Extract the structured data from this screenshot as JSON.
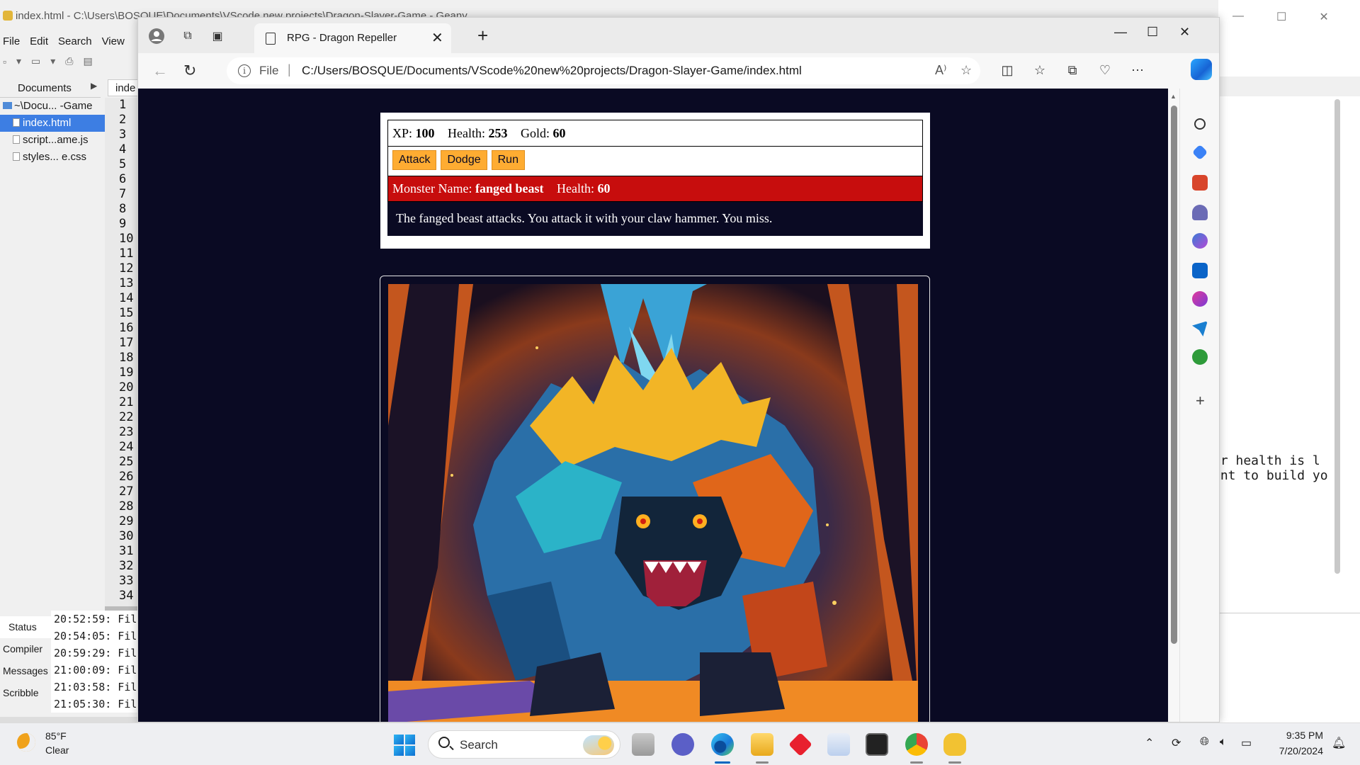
{
  "geany": {
    "title": "index.html - C:\\Users\\BOSQUE\\Documents\\VScode new projects\\Dragon-Slayer-Game - Geany",
    "menu": [
      "File",
      "Edit",
      "Search",
      "View"
    ],
    "sidebar_tab": "Documents",
    "tree": {
      "folder": "~\\Docu... -Game",
      "files": [
        "index.html",
        "script...ame.js",
        "styles...  e.css"
      ]
    },
    "editor_tab": "inde",
    "line_numbers": [
      "1",
      "2",
      "3",
      "4",
      "5",
      "6",
      "7",
      "8",
      "9",
      "10",
      "11",
      "12",
      "13",
      "14",
      "15",
      "16",
      "17",
      "18",
      "19",
      "20",
      "21",
      "22",
      "23",
      "24",
      "25",
      "26",
      "27",
      "28",
      "29",
      "30",
      "31",
      "32",
      "33",
      "34"
    ],
    "msg_tabs": [
      "Status",
      "Compiler",
      "Messages",
      "Scribble"
    ],
    "log": [
      "20:52:59: Fil",
      "20:54:05: Fil",
      "20:59:29: Fil",
      "21:00:09: Fil",
      "21:03:58: Fil",
      "21:05:30: Fil"
    ]
  },
  "background_window": {
    "text_lines": [
      "ur health is l",
      "ant to build yo"
    ]
  },
  "browser": {
    "tab_title": "RPG - Dragon Repeller",
    "url_scheme": "File",
    "url": "C:/Users/BOSQUE/Documents/VScode%20new%20projects/Dragon-Slayer-Game/index.html"
  },
  "game": {
    "stats": {
      "xp_label": "XP:",
      "xp": "100",
      "health_label": "Health:",
      "health": "253",
      "gold_label": "Gold:",
      "gold": "60"
    },
    "buttons": [
      "Attack",
      "Dodge",
      "Run"
    ],
    "monster": {
      "name_label": "Monster Name:",
      "name": "fanged beast",
      "health_label": "Health:",
      "health": "60"
    },
    "text": "The fanged beast attacks. You attack it with your claw hammer. You miss."
  },
  "taskbar": {
    "weather_temp": "85°F",
    "weather_cond": "Clear",
    "search_label": "Search",
    "time": "9:35 PM",
    "date": "7/20/2024"
  }
}
